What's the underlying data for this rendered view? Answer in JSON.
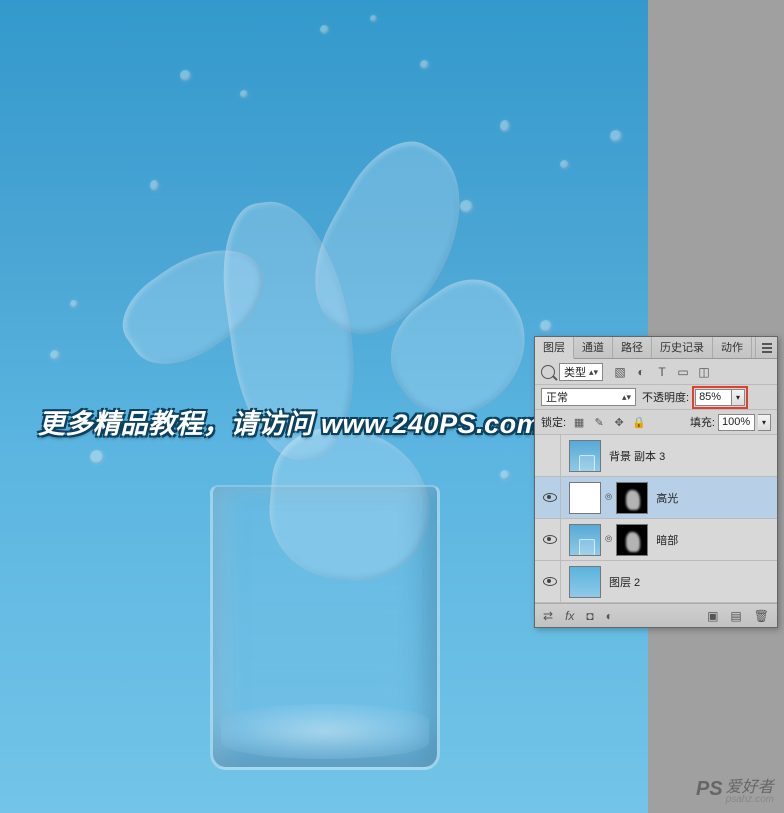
{
  "watermark": {
    "text_prefix": "更多精品教程，请访问 ",
    "url": "www.240PS.com"
  },
  "bottom_watermark": {
    "logo": "PS",
    "text": "爱好者",
    "sub": "psahz.com"
  },
  "panel": {
    "tabs": [
      "图层",
      "通道",
      "路径",
      "历史记录",
      "动作"
    ],
    "active_tab": 0,
    "filter": {
      "kind_label": "类型"
    },
    "blend": {
      "mode": "正常",
      "opacity_label": "不透明度:",
      "opacity_value": "85%"
    },
    "lock": {
      "label": "锁定:",
      "fill_label": "填充:",
      "fill_value": "100%"
    },
    "layers": [
      {
        "visible": false,
        "name": "背景 副本 3",
        "thumbs": [
          "img"
        ]
      },
      {
        "visible": true,
        "name": "高光",
        "thumbs": [
          "mask-white",
          "mask-black"
        ],
        "selected": true,
        "linked": true
      },
      {
        "visible": true,
        "name": "暗部",
        "thumbs": [
          "img",
          "mask-black"
        ],
        "linked": true
      },
      {
        "visible": true,
        "name": "图层 2",
        "thumbs": [
          "solid"
        ]
      }
    ]
  }
}
